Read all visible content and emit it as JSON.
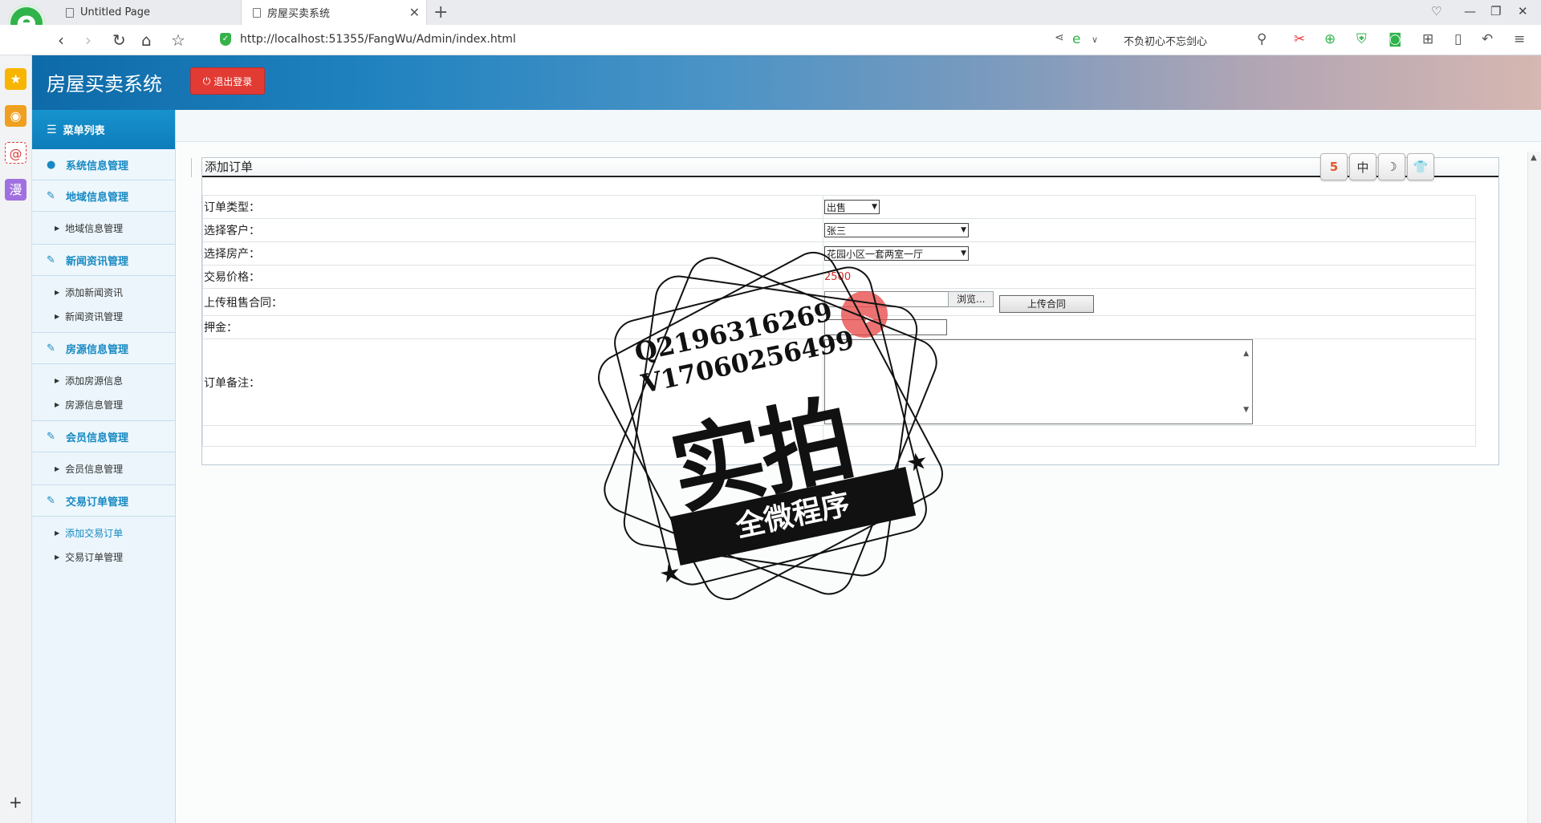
{
  "browser": {
    "tabs": [
      {
        "label": "Untitled Page"
      },
      {
        "label": "房屋买卖系统"
      }
    ],
    "url": "http://localhost:51355/FangWu/Admin/index.html",
    "search_text": "不负初心不忘剑心"
  },
  "app": {
    "title": "房屋买卖系统",
    "logout_label": "退出登录"
  },
  "sidebar": {
    "menu_title": "菜单列表",
    "groups": [
      {
        "label": "系统信息管理",
        "items": []
      },
      {
        "label": "地域信息管理",
        "items": [
          "地域信息管理"
        ]
      },
      {
        "label": "新闻资讯管理",
        "items": [
          "添加新闻资讯",
          "新闻资讯管理"
        ]
      },
      {
        "label": "房源信息管理",
        "items": [
          "添加房源信息",
          "房源信息管理"
        ]
      },
      {
        "label": "会员信息管理",
        "items": [
          "会员信息管理"
        ]
      },
      {
        "label": "交易订单管理",
        "items": [
          "添加交易订单",
          "交易订单管理"
        ]
      }
    ]
  },
  "panel": {
    "title": "添加订单",
    "tools": [
      "5",
      "中",
      "☽",
      "👕"
    ]
  },
  "form": {
    "order_type_label": "订单类型：",
    "order_type_value": "出售",
    "customer_label": "选择客户：",
    "customer_value": "张三",
    "property_label": "选择房产：",
    "property_value": "花园小区一套两室一厅",
    "price_label": "交易价格：",
    "price_value": "2500",
    "contract_label": "上传租售合同：",
    "browse_label": "浏览...",
    "upload_label": "上传合同",
    "deposit_label": "押金：",
    "remark_label": "订单备注："
  },
  "watermark": {
    "line1": "Q2196316269",
    "line2": "V17060256499",
    "big": "实拍",
    "ribbon": "全微程序"
  }
}
